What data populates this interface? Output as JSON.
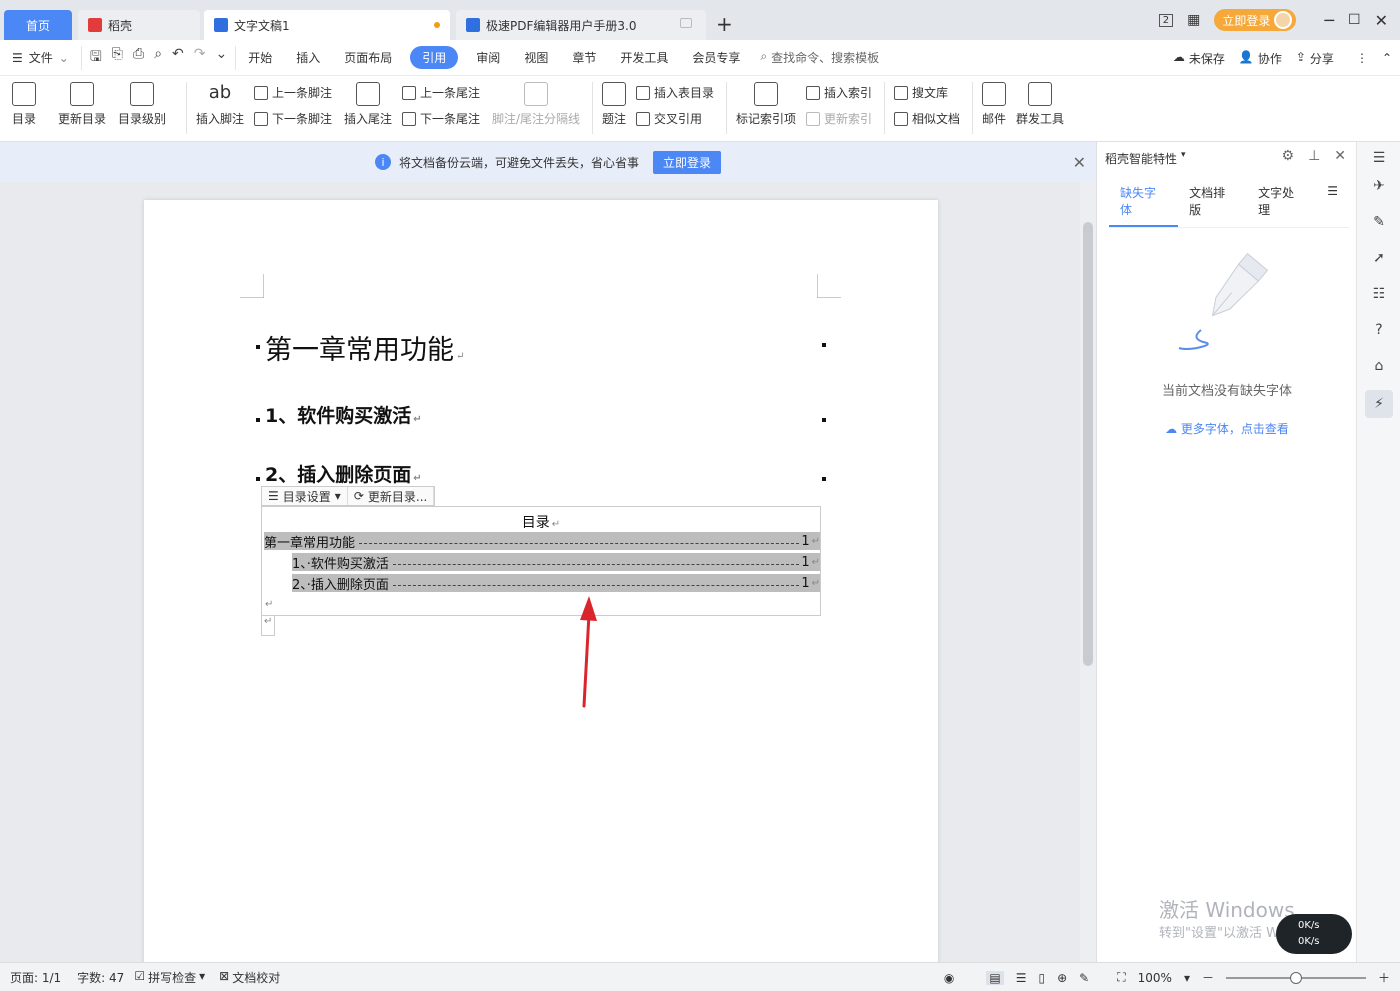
{
  "tabs": {
    "home": "首页",
    "daoke": "稻壳",
    "doc": "文字文稿1",
    "pdf": "极速PDF编辑器用户手册3.0",
    "new_tab": "+"
  },
  "titlebar": {
    "page_count_badge": "2",
    "login_label": "立即登录"
  },
  "menu": {
    "file": "文件",
    "items": [
      "开始",
      "插入",
      "页面布局",
      "引用",
      "审阅",
      "视图",
      "章节",
      "开发工具",
      "会员专享"
    ],
    "active": "引用",
    "search_placeholder": "查找命令、搜索模板",
    "unsaved": "未保存",
    "collab": "协作",
    "share": "分享"
  },
  "ribbon": {
    "toc": "目录",
    "update_toc": "更新目录",
    "toc_level": "目录级别",
    "insert_footnote": "插入脚注",
    "prev_footnote": "上一条脚注",
    "next_footnote": "下一条脚注",
    "insert_endnote": "插入尾注",
    "prev_endnote": "上一条尾注",
    "next_endnote": "下一条尾注",
    "note_separator": "脚注/尾注分隔线",
    "caption": "题注",
    "insert_table_toc": "插入表目录",
    "cross_ref": "交叉引用",
    "mark_index": "标记索引项",
    "insert_index": "插入索引",
    "update_index": "更新索引",
    "search_library": "搜文库",
    "similar_docs": "相似文档",
    "mail": "邮件",
    "mass_tools": "群发工具"
  },
  "notice": {
    "text": "将文档备份云端，可避免文件丢失，省心省事",
    "button": "立即登录"
  },
  "document": {
    "heading1": "第一章常用功能",
    "heading2a": "1、软件购买激活",
    "heading2b": "2、插入删除页面",
    "para_mark": "↵",
    "toc_toolbar": {
      "settings": "目录设置",
      "update": "更新目录..."
    },
    "toc_title": "目录",
    "toc_entries": [
      {
        "text": "第一章常用功能",
        "page": "1"
      },
      {
        "text": "1、·软件购买激活",
        "page": "1"
      },
      {
        "text": "2、·插入删除页面",
        "page": "1"
      }
    ]
  },
  "right_panel": {
    "title": "稻壳智能特性",
    "tabs": [
      "缺失字体",
      "文档排版",
      "文字处理"
    ],
    "active_tab": "缺失字体",
    "empty_text": "当前文档没有缺失字体",
    "more_link": "更多字体，点击查看",
    "watermark_line1": "激活 Windows",
    "watermark_line2": "转到\"设置\"以激活 Windows。"
  },
  "statusbar": {
    "page": "页面: 1/1",
    "word_count": "字数: 47",
    "spell_check": "拼写检查",
    "proofread": "文档校对",
    "zoom": "100%",
    "zoom_fraction": 0.5
  },
  "speed_widget": {
    "upload": "0K/s",
    "download": "0K/s"
  },
  "colors": {
    "accent": "#4b87f5",
    "login_orange": "#f6a83a",
    "toc_highlight": "#bdbdbd",
    "arrow_red": "#d9262c"
  }
}
